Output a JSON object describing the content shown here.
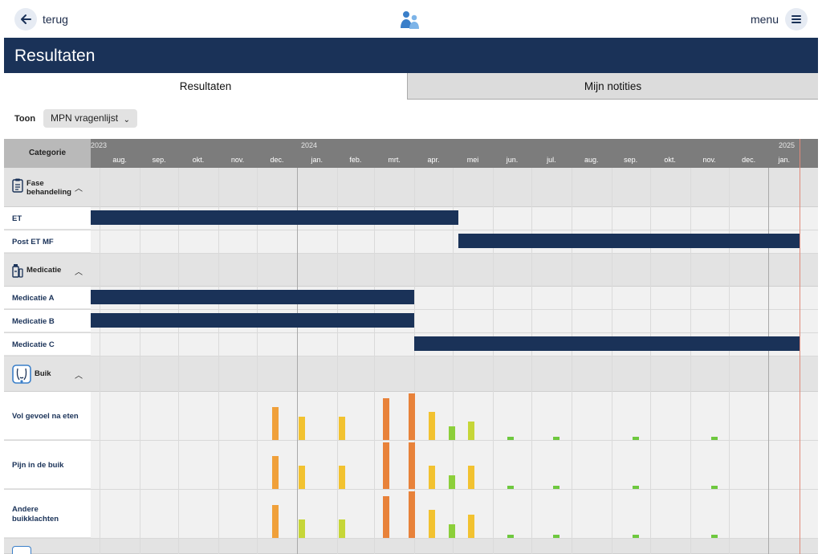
{
  "nav": {
    "back_label": "terug",
    "menu_label": "menu"
  },
  "header": {
    "title": "Resultaten"
  },
  "tabs": [
    {
      "label": "Resultaten",
      "active": true
    },
    {
      "label": "Mijn notities",
      "active": false
    }
  ],
  "filter": {
    "label": "Toon",
    "selected": "MPN vragenlijst"
  },
  "timeline": {
    "category_header": "Categorie",
    "years": [
      "2023",
      "2024",
      "2025"
    ],
    "months": [
      "aug.",
      "sep.",
      "okt.",
      "nov.",
      "dec.",
      "jan.",
      "feb.",
      "mrt.",
      "apr.",
      "mei",
      "jun.",
      "jul.",
      "aug.",
      "sep.",
      "okt.",
      "nov.",
      "dec.",
      "jan."
    ]
  },
  "groups": [
    {
      "label": "Fase behandeling",
      "icon": "clipboard-icon",
      "rows": [
        {
          "label": "ET",
          "bar": {
            "from": "2023-07-25",
            "to": "2024-05-05"
          }
        },
        {
          "label": "Post ET MF",
          "bar": {
            "from": "2024-05-05",
            "to": "2025-01-25"
          }
        }
      ]
    },
    {
      "label": "Medicatie",
      "icon": "medication-icon",
      "rows": [
        {
          "label": "Medicatie A",
          "bar": {
            "from": "2023-07-25",
            "to": "2024-04-01"
          }
        },
        {
          "label": "Medicatie B",
          "bar": {
            "from": "2023-07-25",
            "to": "2024-04-01"
          }
        },
        {
          "label": "Medicatie C",
          "bar": {
            "from": "2024-04-01",
            "to": "2025-01-25"
          }
        }
      ]
    },
    {
      "label": "Buik",
      "icon": "abdomen-icon",
      "rows": [
        {
          "label": "Vol gevoel na eten"
        },
        {
          "label": "Pijn in de buik"
        },
        {
          "label": "Andere buikklachten"
        }
      ]
    }
  ],
  "colors": {
    "header": "#1a3258",
    "bar": "#1a3258",
    "today": "#e08a7a",
    "score_high": "#e8823a",
    "score_mid": "#f0a03a",
    "score_yellow": "#f2c230",
    "score_lime": "#c6d638",
    "score_green": "#8ccf3a",
    "score_low": "#6ec83e"
  },
  "symptom_scores": {
    "dates": [
      "2023-12-15",
      "2024-01-05",
      "2024-02-05",
      "2024-03-10",
      "2024-03-30",
      "2024-04-15",
      "2024-04-30",
      "2024-05-15",
      "2024-06-15",
      "2024-07-20",
      "2024-09-20",
      "2024-11-20"
    ],
    "scale_max": 10,
    "series": [
      {
        "label": "Vol gevoel na eten",
        "values": [
          7,
          5,
          5,
          9,
          10,
          6,
          3,
          4,
          0.5,
          0.5,
          0.5,
          0.5
        ]
      },
      {
        "label": "Pijn in de buik",
        "values": [
          7,
          5,
          5,
          10,
          10,
          5,
          3,
          5,
          0.5,
          0.5,
          0.5,
          0.5
        ]
      },
      {
        "label": "Andere buikklachten",
        "values": [
          7,
          4,
          4,
          9,
          10,
          6,
          3,
          5,
          0.5,
          0.5,
          0.5,
          0.5
        ]
      }
    ]
  }
}
